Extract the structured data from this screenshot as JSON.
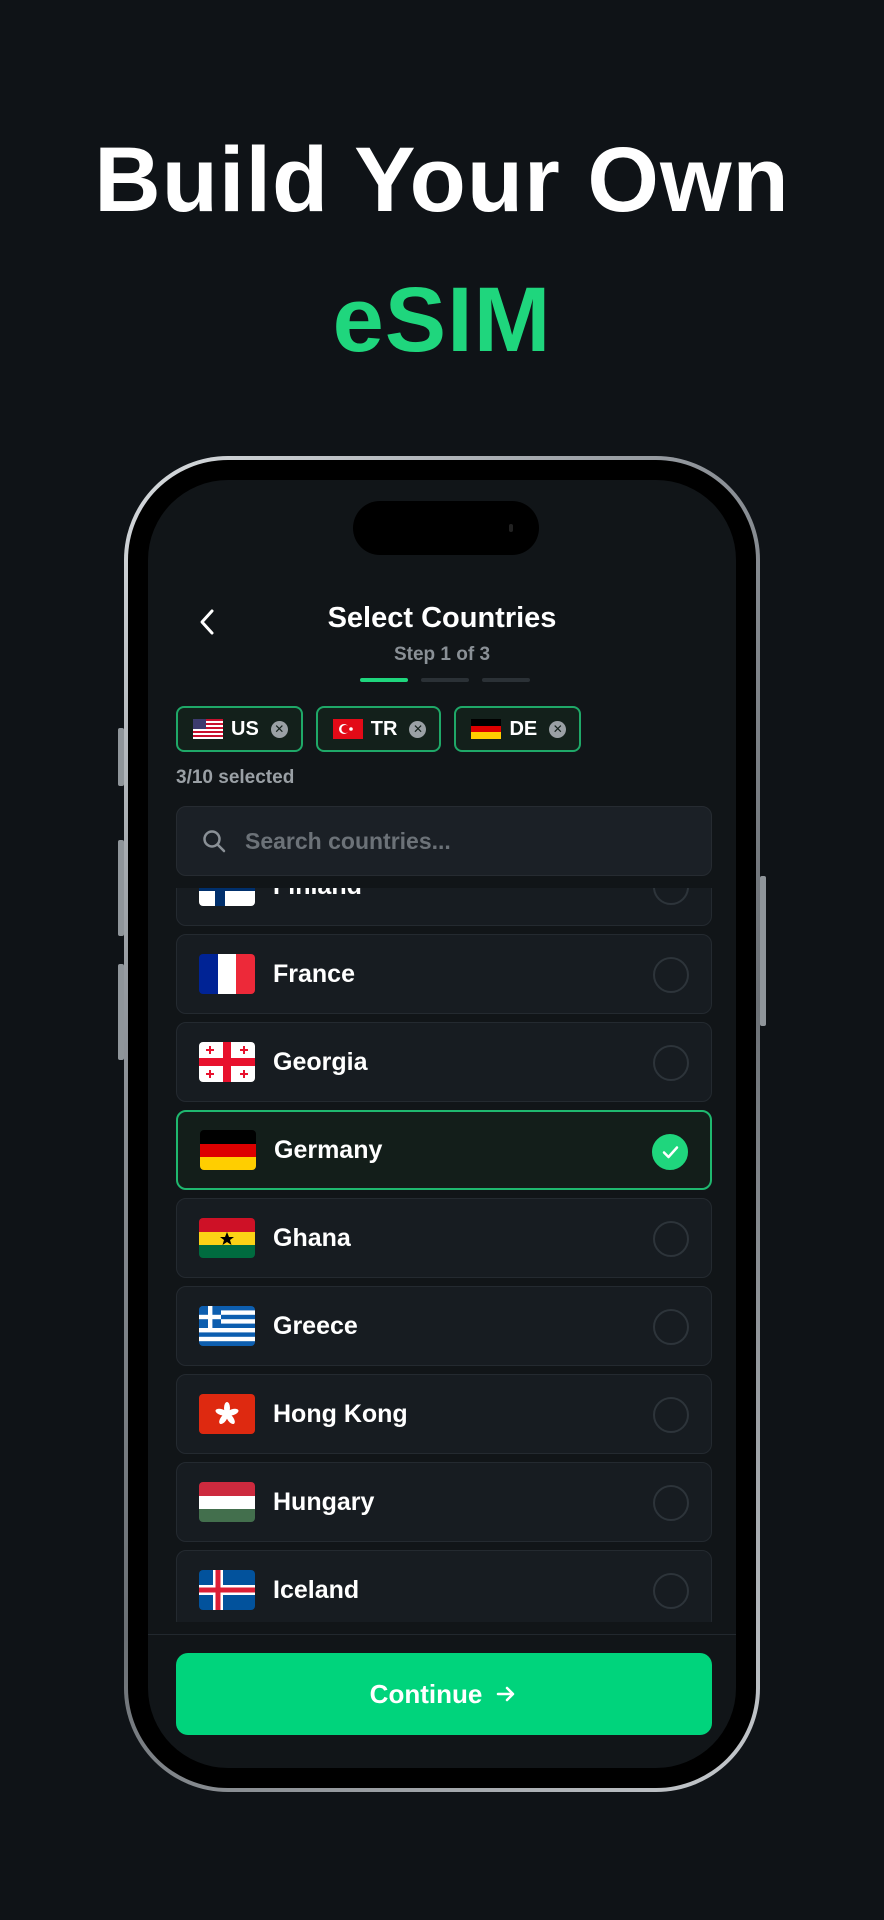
{
  "headline": {
    "line1": "Build Your Own",
    "line2": "eSIM"
  },
  "header": {
    "title": "Select Countries",
    "step": "Step 1 of 3"
  },
  "chips": [
    {
      "code": "US",
      "flag": "us-flag"
    },
    {
      "code": "TR",
      "flag": "tr-flag"
    },
    {
      "code": "DE",
      "flag": "de-flag"
    }
  ],
  "selected_count": "3/10 selected",
  "search": {
    "placeholder": "Search countries..."
  },
  "countries": [
    {
      "name": "Finland",
      "flag": "fi-flag",
      "selected": false
    },
    {
      "name": "France",
      "flag": "fr-flag",
      "selected": false
    },
    {
      "name": "Georgia",
      "flag": "ge-flag",
      "selected": false
    },
    {
      "name": "Germany",
      "flag": "de-flag",
      "selected": true
    },
    {
      "name": "Ghana",
      "flag": "gh-flag",
      "selected": false
    },
    {
      "name": "Greece",
      "flag": "gr-flag",
      "selected": false
    },
    {
      "name": "Hong Kong",
      "flag": "hk-flag",
      "selected": false
    },
    {
      "name": "Hungary",
      "flag": "hu-flag",
      "selected": false
    },
    {
      "name": "Iceland",
      "flag": "is-flag",
      "selected": false
    }
  ],
  "continue_label": "Continue",
  "colors": {
    "accent": "#1fd67d",
    "background": "#0f1317",
    "card": "#171c21"
  }
}
